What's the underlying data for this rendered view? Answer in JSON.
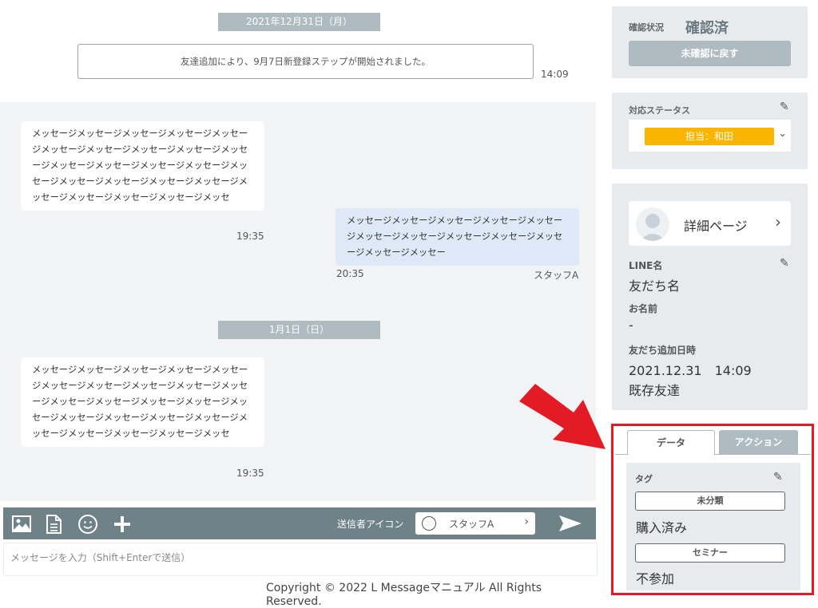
{
  "chat": {
    "date_1": "2021年12月31日（月）",
    "system_message": "友達追加により、9月7日新登録ステップが開始されました。",
    "system_time": "14:09",
    "msg_in_1": "メッセージメッセージメッセージメッセージメッセージメッセージメッセージメッセージメッセージメッセージメッセージメッセージメッセージメッセージメッセージメッセージメッセージメッセージメッセージメッセージメッセージメッセージメッセージメッセ",
    "msg_in_1_time": "19:35",
    "msg_out_1": "メッセージメッセージメッセージメッセージメッセージメッセージメッセージメッセージメッセージメッセージメッセージメッセー",
    "msg_out_1_time": "20:35",
    "msg_out_1_staff": "スタッフA",
    "date_2": "1月1日（日）",
    "msg_in_2": "メッセージメッセージメッセージメッセージメッセージメッセージメッセージメッセージメッセージメッセージメッセージメッセージメッセージメッセージメッセージメッセージメッセージメッセージメッセージメッセージメッセージメッセージメッセージメッセ",
    "msg_in_2_time": "19:35"
  },
  "toolbar": {
    "sender_label": "送信者アイコン",
    "sender_name": "スタッフA",
    "icons": [
      "image-icon",
      "document-icon",
      "emoji-icon",
      "plus-icon",
      "send-icon"
    ]
  },
  "input": {
    "placeholder": "メッセージを入力（Shift+Enterで送信）"
  },
  "footer": {
    "copyright": "Copyright © 2022 L Messageマニュアル All Rights Reserved."
  },
  "confirm": {
    "label": "確認状況",
    "value": "確認済",
    "back_button": "未確認に戻す"
  },
  "status": {
    "label": "対応ステータス",
    "selected": "担当：和田"
  },
  "profile": {
    "detail_label": "詳細ページ",
    "line_name_label": "LINE名",
    "line_name_value": "友だち名",
    "name_label": "お名前",
    "name_value": "-",
    "added_label": "友だち追加日時",
    "added_value": "2021.12.31　14:09",
    "type_value": "既存友達"
  },
  "tabs": {
    "data": "データ",
    "action": "アクション"
  },
  "tags": {
    "label": "タグ",
    "group_1": "未分類",
    "value_1": "購入済み",
    "group_2": "セミナー",
    "value_2": "不参加"
  },
  "colors": {
    "highlight": "#e21b25",
    "status_chip": "#f9b500",
    "toolbar": "#6f8288",
    "outgoing_bubble": "#dde9f6"
  }
}
